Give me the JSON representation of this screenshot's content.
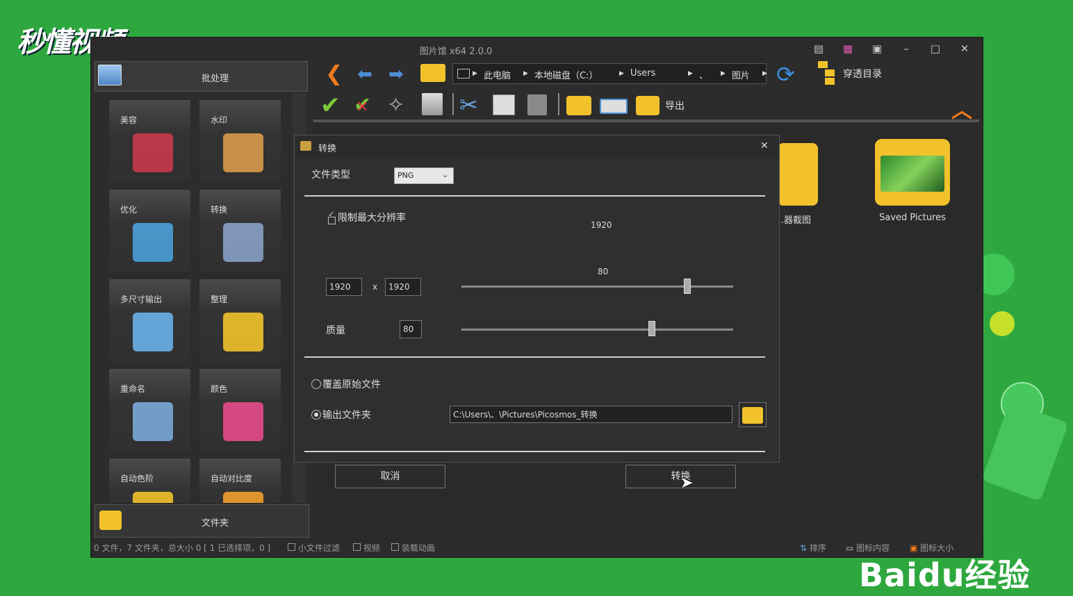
{
  "watermarks": {
    "top_left": "秒懂视频",
    "bottom_right": "Baidu经验"
  },
  "window": {
    "title": "图片馆 x64 2.0.0",
    "controls": {
      "minimize": "–",
      "maximize": "□",
      "close": "✕"
    }
  },
  "left_panel": {
    "batch_label": "批处理",
    "tiles": [
      {
        "label": "美容",
        "icon": "makeup-icon"
      },
      {
        "label": "水印",
        "icon": "watermark-icon"
      },
      {
        "label": "优化",
        "icon": "optimize-icon"
      },
      {
        "label": "转换",
        "icon": "convert-icon"
      },
      {
        "label": "多尺寸输出",
        "icon": "multisize-icon"
      },
      {
        "label": "整理",
        "icon": "organize-icon"
      },
      {
        "label": "重命名",
        "icon": "rename-icon"
      },
      {
        "label": "颜色",
        "icon": "color-icon"
      },
      {
        "label": "自动色阶",
        "icon": "auto-levels-icon"
      },
      {
        "label": "自动对比度",
        "icon": "auto-contrast-icon"
      }
    ],
    "folder_label": "文件夹"
  },
  "address_bar": {
    "crumbs": [
      "此电脑",
      "本地磁盘（C:）",
      "Users",
      "、",
      "图片"
    ],
    "through_dir_label": "穿透目录"
  },
  "toolbar": {
    "export_label": "导出"
  },
  "content": {
    "items": [
      {
        "label": "…器截图"
      },
      {
        "label": "Saved Pictures"
      }
    ]
  },
  "dialog": {
    "title": "转换",
    "close": "✕",
    "file_type_label": "文件类型",
    "file_type_value": "PNG",
    "limit_res_label": "限制最大分辨率",
    "limit_res_checked": true,
    "width_value": "1920",
    "height_value": "1920",
    "times_sign": "x",
    "res_slider_label": "1920",
    "res_slider_fraction": 0.83,
    "quality_label": "质量",
    "quality_value": "80",
    "quality_slider_label": "80",
    "quality_slider_fraction": 0.7,
    "overwrite_label": "覆盖原始文件",
    "output_folder_label": "输出文件夹",
    "output_path": "C:\\Users\\、\\Pictures\\Picosmos_转换",
    "cancel_label": "取消",
    "convert_label": "转换"
  },
  "status": {
    "summary": "0 文件，7 文件夹，总大小 0 [ 1 已选择项，0 ]",
    "small_file_filter": "小文件过滤",
    "video": "视频",
    "load_animation": "装载动画",
    "sort": "排序",
    "icon_content": "图标内容",
    "icon_size": "图标大小"
  }
}
